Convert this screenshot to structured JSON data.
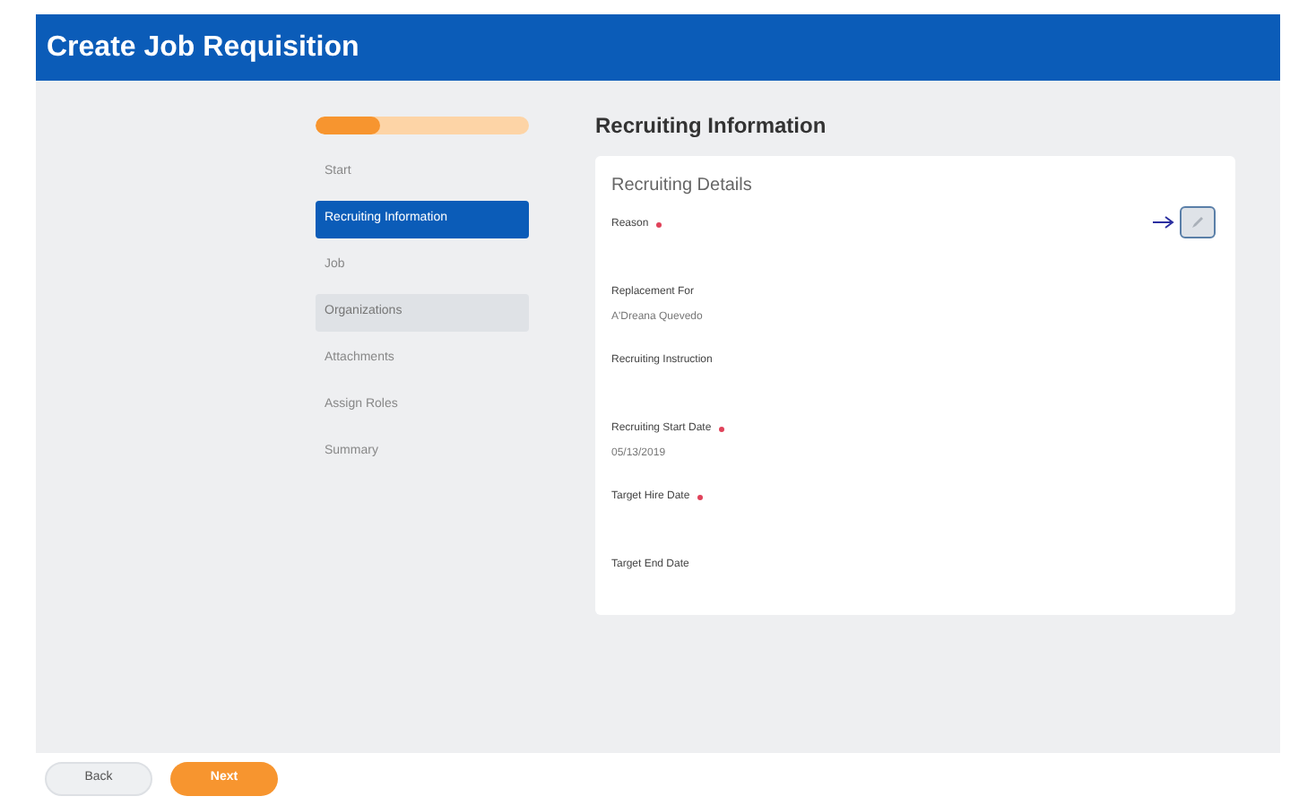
{
  "header": {
    "title": "Create Job Requisition"
  },
  "progress": {
    "level": 0.3
  },
  "steps": [
    {
      "label": "Start",
      "selected": false,
      "hovered": false
    },
    {
      "label": "Recruiting Information",
      "selected": true,
      "hovered": false
    },
    {
      "label": "Job",
      "selected": false,
      "hovered": false
    },
    {
      "label": "Organizations",
      "selected": false,
      "hovered": true
    },
    {
      "label": "Attachments",
      "selected": false,
      "hovered": false
    },
    {
      "label": "Assign Roles",
      "selected": false,
      "hovered": false
    },
    {
      "label": "Summary",
      "selected": false,
      "hovered": false
    }
  ],
  "section_title": "Recruiting Information",
  "card": {
    "title": "Recruiting Details",
    "fields": [
      {
        "label": "Reason",
        "required": true,
        "editable": true
      },
      {
        "label": "Replacement For",
        "required": false,
        "value": "A'Dreana Quevedo"
      },
      {
        "label": "Recruiting Instruction",
        "required": false
      },
      {
        "label": "Recruiting Start Date",
        "required": true,
        "value": "05/13/2019"
      },
      {
        "label": "Target Hire Date",
        "required": true
      },
      {
        "label": "Target End Date",
        "required": false
      }
    ]
  },
  "buttons": [
    {
      "label": "Back",
      "kind": "secondary"
    },
    {
      "label": "Next",
      "kind": "primary"
    }
  ]
}
